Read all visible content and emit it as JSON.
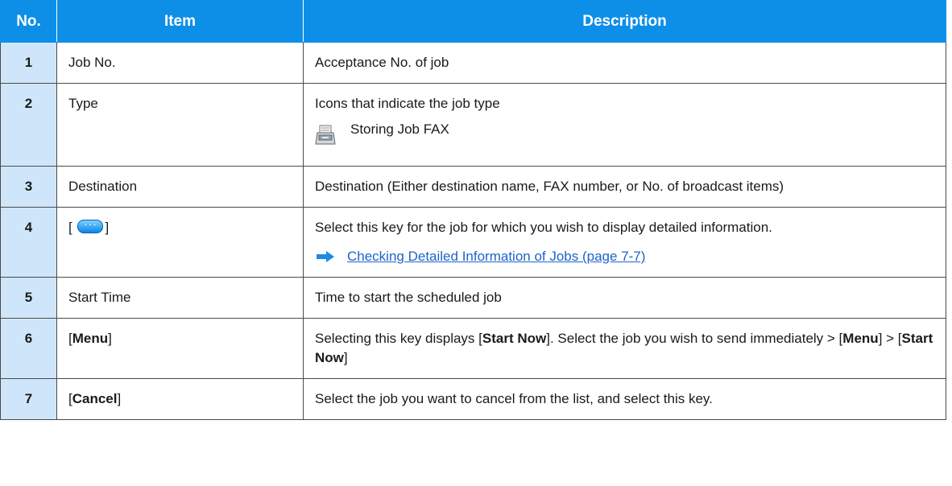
{
  "headers": {
    "no": "No.",
    "item": "Item",
    "description": "Description"
  },
  "rows": [
    {
      "no": "1",
      "item": "Job No.",
      "description": "Acceptance No. of job"
    },
    {
      "no": "2",
      "item": "Type",
      "description": "Icons that indicate the job type",
      "icon_label": "Storing Job FAX",
      "icon": "fax-machine-icon"
    },
    {
      "no": "3",
      "item": "Destination",
      "description": "Destination (Either destination name, FAX number, or No. of broadcast items)"
    },
    {
      "no": "4",
      "item_pre": "[ ",
      "item_icon": "detail-button-icon",
      "item_post": "]",
      "description": "Select this key for the job for which you wish to display detailed information.",
      "link": "Checking Detailed Information of Jobs (page 7-7)"
    },
    {
      "no": "5",
      "item": "Start Time",
      "description": "Time to start the scheduled job"
    },
    {
      "no": "6",
      "item_pre": "[",
      "item_bold": "Menu",
      "item_post": "]",
      "desc_parts": [
        "Selecting this key displays [",
        "Start Now",
        "]. Select the job you wish to send immediately > [",
        "Menu",
        "] > [",
        "Start Now",
        "]"
      ]
    },
    {
      "no": "7",
      "item_pre": "[",
      "item_bold": "Cancel",
      "item_post": "]",
      "description": "Select the job you want to cancel from the list, and select this key."
    }
  ],
  "colors": {
    "header_bg": "#0d8fe8",
    "num_bg": "#cfe6fa",
    "link": "#1e64c8",
    "arrow": "#1e8ae6"
  }
}
